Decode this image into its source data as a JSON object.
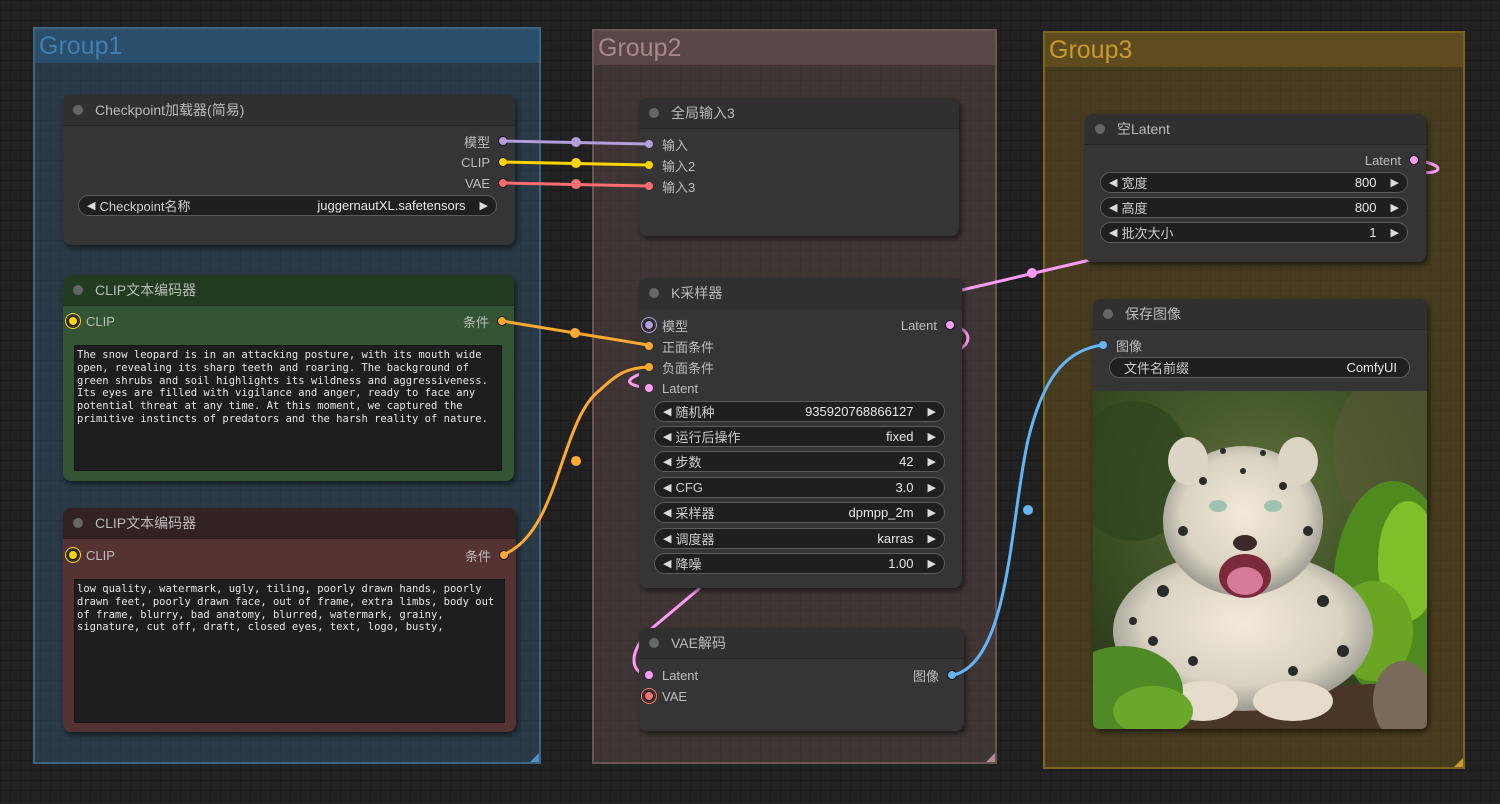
{
  "groups": [
    {
      "title": "Group1",
      "color": "#3f7fb3"
    },
    {
      "title": "Group2",
      "color": "#a88888"
    },
    {
      "title": "Group3",
      "color": "#c89a2a"
    }
  ],
  "slot_colors": {
    "model": "#b39ddb",
    "clip": "#ffd500",
    "vae": "#ff6e6e",
    "conditioning": "#ffa931",
    "latent": "#ff9cf9",
    "image": "#64b5f6"
  },
  "checkpoint_loader": {
    "title": "Checkpoint加载器(简易)",
    "outputs": [
      "模型",
      "CLIP",
      "VAE"
    ],
    "widget": {
      "label": "Checkpoint名称",
      "value": "juggernautXL.safetensors"
    }
  },
  "clip_positive": {
    "title": "CLIP文本编码器",
    "input": "CLIP",
    "output": "条件",
    "text": "The snow leopard is in an attacking posture, with its mouth wide open, revealing its sharp teeth and roaring. The background of green shrubs and soil highlights its wildness and aggressiveness. Its eyes are filled with vigilance and anger, ready to face any potential threat at any time. At this moment, we captured the primitive instincts of predators and the harsh reality of nature."
  },
  "clip_negative": {
    "title": "CLIP文本编码器",
    "input": "CLIP",
    "output": "条件",
    "text": "low quality, watermark, ugly, tiling, poorly drawn hands, poorly drawn feet, poorly drawn face, out of frame, extra limbs, body out of frame, blurry, bad anatomy, blurred, watermark, grainy, signature, cut off, draft, closed eyes, text, logo, busty,"
  },
  "global_input": {
    "title": "全局输入3",
    "inputs": [
      "输入",
      "输入2",
      "输入3"
    ]
  },
  "ksampler": {
    "title": "K采样器",
    "inputs": [
      "模型",
      "正面条件",
      "负面条件",
      "Latent"
    ],
    "output": "Latent",
    "widgets": [
      {
        "label": "随机种",
        "value": "935920768866127"
      },
      {
        "label": "运行后操作",
        "value": "fixed"
      },
      {
        "label": "步数",
        "value": "42"
      },
      {
        "label": "CFG",
        "value": "3.0"
      },
      {
        "label": "采样器",
        "value": "dpmpp_2m"
      },
      {
        "label": "调度器",
        "value": "karras"
      },
      {
        "label": "降噪",
        "value": "1.00"
      }
    ]
  },
  "vae_decode": {
    "title": "VAE解码",
    "inputs": [
      "Latent",
      "VAE"
    ],
    "output": "图像"
  },
  "empty_latent": {
    "title": "空Latent",
    "output": "Latent",
    "widgets": [
      {
        "label": "宽度",
        "value": "800"
      },
      {
        "label": "高度",
        "value": "800"
      },
      {
        "label": "批次大小",
        "value": "1"
      }
    ]
  },
  "save_image": {
    "title": "保存图像",
    "input": "图像",
    "widget": {
      "label": "文件名前缀",
      "value": "ComfyUI"
    },
    "preview_alt": "snow leopard roaring among green shrubs"
  },
  "arrows": {
    "left": "◀",
    "right": "▶"
  }
}
